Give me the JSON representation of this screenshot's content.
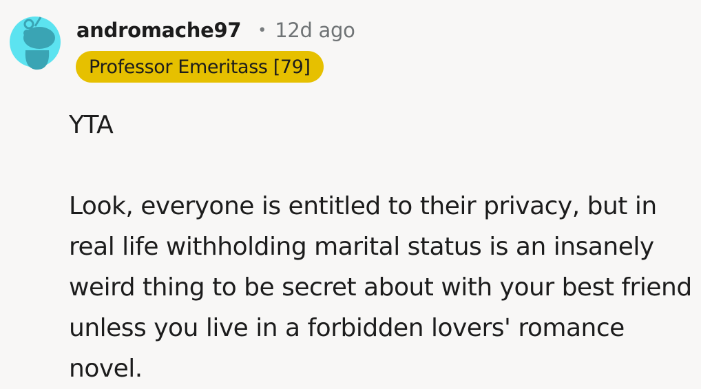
{
  "comment": {
    "author": "andromache97",
    "separator": "•",
    "age": "12d ago",
    "flair": "Professor Emeritass [79]",
    "paragraphs": [
      "YTA",
      "Look, everyone is entitled to their privacy, but in real life withholding marital status is an insanely weird thing to be secret about with your best friend unless you live in a forbidden lovers' romance novel."
    ]
  },
  "avatar": {
    "icon": "snoo-avatar-icon",
    "bg_color": "#5ce3f0",
    "fg_color": "#3aa4b4"
  },
  "colors": {
    "flair_bg": "#e6c000",
    "page_bg": "#f8f7f6"
  }
}
